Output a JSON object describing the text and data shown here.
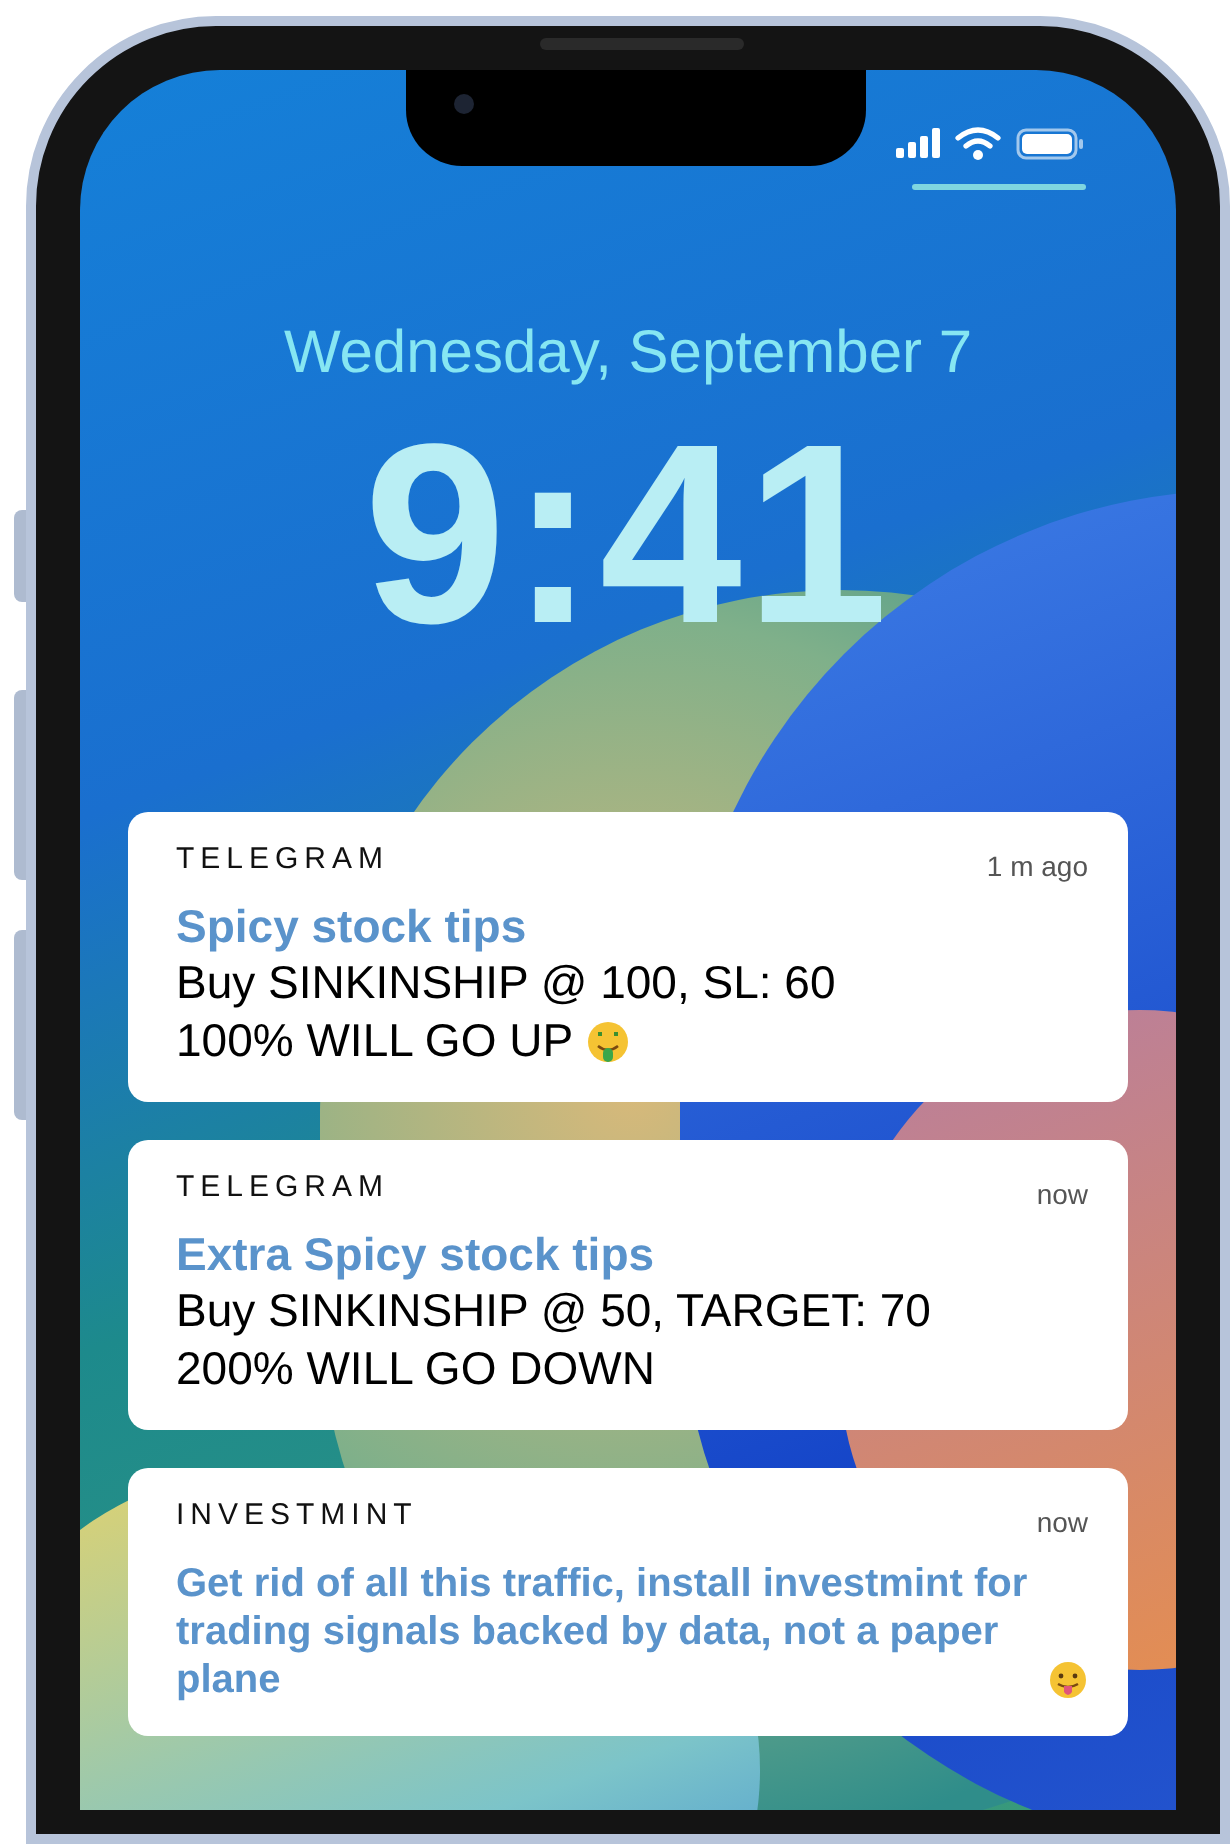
{
  "lock_screen": {
    "date": "Wednesday, September 7",
    "time": "9:41"
  },
  "notifications": [
    {
      "app": "TELEGRAM",
      "time": "1 m ago",
      "kind": "message",
      "title": "Spicy stock tips",
      "body_lines": [
        "Buy SINKINSHIP @ 100, SL: 60",
        "100% WILL GO UP"
      ],
      "trailing_emoji": {
        "kind": "money"
      }
    },
    {
      "app": "TELEGRAM",
      "time": "now",
      "kind": "message",
      "title": "Extra Spicy stock tips",
      "body_lines": [
        "Buy SINKINSHIP @ 50, TARGET: 70",
        "200% WILL GO DOWN"
      ]
    },
    {
      "app": "INVESTMINT",
      "time": "now",
      "kind": "promo",
      "text": "Get rid of all this traffic, install investmint for trading signals backed by data, not a paper plane",
      "trailing_emoji": {
        "kind": "tongue"
      }
    }
  ]
}
